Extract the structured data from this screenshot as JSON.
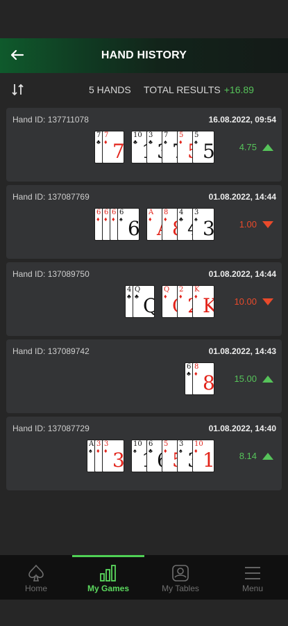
{
  "header": {
    "title": "HAND HISTORY",
    "back_icon": "back-arrow-icon"
  },
  "summary": {
    "hands_label": "5 HANDS",
    "total_label": "TOTAL RESULTS",
    "total_value": "+16.89",
    "sort_icon": "sort-icon"
  },
  "hands": [
    {
      "id": "Hand ID: 137711078",
      "date": "16.08.2022, 09:54",
      "result": "4.75",
      "direction": "up",
      "hole": [
        {
          "r": "7",
          "s": "♣",
          "c": "blk"
        },
        {
          "r": "7",
          "s": "♦",
          "c": "red"
        }
      ],
      "board": [
        {
          "r": "10",
          "s": "♣",
          "c": "blk"
        },
        {
          "r": "3",
          "s": "♣",
          "c": "blk"
        },
        {
          "r": "7",
          "s": "♠",
          "c": "blk"
        },
        {
          "r": "5",
          "s": "♦",
          "c": "red"
        },
        {
          "r": "5",
          "s": "♠",
          "c": "blk"
        }
      ]
    },
    {
      "id": "Hand ID: 137087769",
      "date": "01.08.2022, 14:44",
      "result": "1.00",
      "direction": "down",
      "hole": [
        {
          "r": "6",
          "s": "♦",
          "c": "red"
        },
        {
          "r": "6",
          "s": "♦",
          "c": "red"
        },
        {
          "r": "6",
          "s": "♦",
          "c": "red"
        },
        {
          "r": "6",
          "s": "♠",
          "c": "blk"
        }
      ],
      "board": [
        {
          "r": "A",
          "s": "♦",
          "c": "red"
        },
        {
          "r": "8",
          "s": "♦",
          "c": "red"
        },
        {
          "r": "4",
          "s": "♣",
          "c": "blk"
        },
        {
          "r": "3",
          "s": "♠",
          "c": "blk"
        }
      ]
    },
    {
      "id": "Hand ID: 137089750",
      "date": "01.08.2022, 14:44",
      "result": "10.00",
      "direction": "down",
      "hole": [
        {
          "r": "4",
          "s": "♣",
          "c": "blk"
        },
        {
          "r": "Q",
          "s": "♣",
          "c": "blk"
        }
      ],
      "board": [
        {
          "r": "Q",
          "s": "♦",
          "c": "red"
        },
        {
          "r": "2",
          "s": "♦",
          "c": "red"
        },
        {
          "r": "K",
          "s": "♦",
          "c": "red"
        }
      ]
    },
    {
      "id": "Hand ID: 137089742",
      "date": "01.08.2022, 14:43",
      "result": "15.00",
      "direction": "up",
      "hole": [
        {
          "r": "6",
          "s": "♣",
          "c": "blk"
        },
        {
          "r": "8",
          "s": "♦",
          "c": "red"
        }
      ],
      "board": []
    },
    {
      "id": "Hand ID: 137087729",
      "date": "01.08.2022, 14:40",
      "result": "8.14",
      "direction": "up",
      "hole": [
        {
          "r": "A",
          "s": "♠",
          "c": "blk"
        },
        {
          "r": "3",
          "s": "♦",
          "c": "red"
        },
        {
          "r": "3",
          "s": "♦",
          "c": "red"
        }
      ],
      "board": [
        {
          "r": "10",
          "s": "♠",
          "c": "blk"
        },
        {
          "r": "6",
          "s": "♣",
          "c": "blk"
        },
        {
          "r": "5",
          "s": "♦",
          "c": "red"
        },
        {
          "r": "3",
          "s": "♠",
          "c": "blk"
        },
        {
          "r": "10",
          "s": "♦",
          "c": "red"
        }
      ]
    }
  ],
  "nav": {
    "items": [
      {
        "label": "Home",
        "icon": "spade-icon"
      },
      {
        "label": "My Games",
        "icon": "bar-chart-icon"
      },
      {
        "label": "My Tables",
        "icon": "tables-icon"
      },
      {
        "label": "Menu",
        "icon": "menu-icon"
      }
    ],
    "active": "My Games"
  },
  "colors": {
    "accent_green": "#56c35a",
    "loss_red": "#e94a2b",
    "card_bg": "#333436"
  }
}
